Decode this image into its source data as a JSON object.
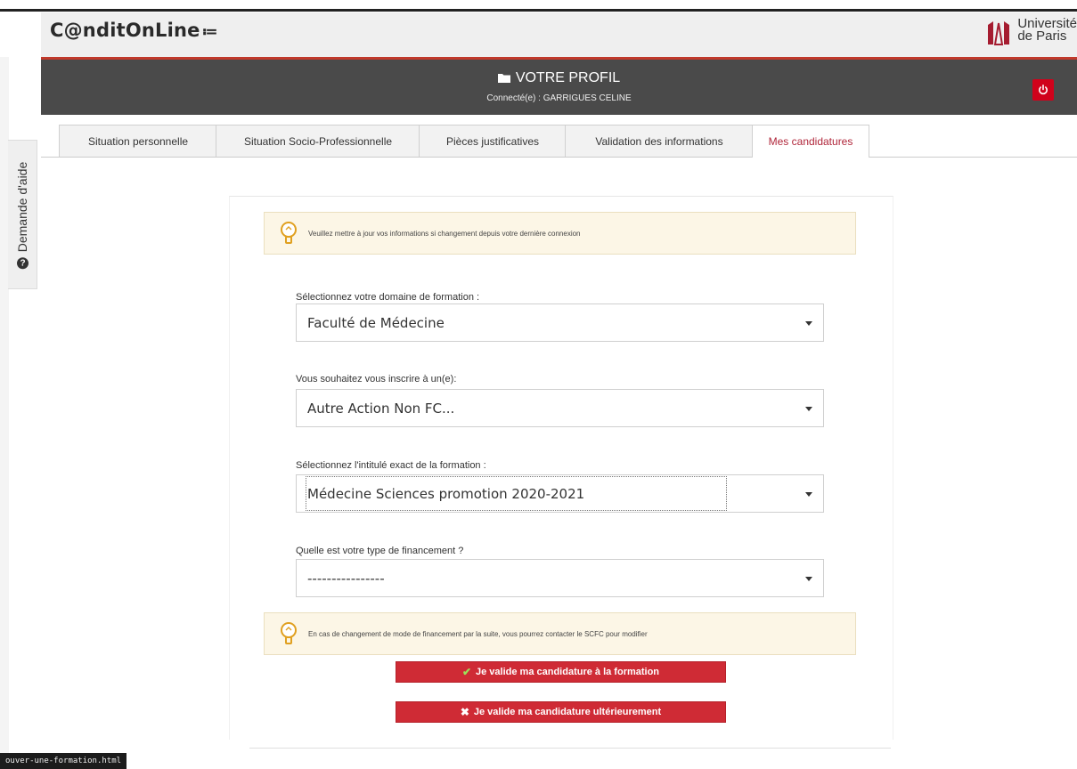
{
  "header": {
    "logo": "C@nditOnLine",
    "university_line1": "Université",
    "university_line2": "de Paris"
  },
  "banner": {
    "title": "VOTRE PROFIL",
    "connected": "Connecté(e) : GARRIGUES CELINE"
  },
  "tabs": [
    {
      "label": "Situation personnelle",
      "active": false
    },
    {
      "label": "Situation Socio-Professionnelle",
      "active": false
    },
    {
      "label": "Pièces justificatives",
      "active": false
    },
    {
      "label": "Validation des informations",
      "active": false
    },
    {
      "label": "Mes candidatures",
      "active": true
    }
  ],
  "help": {
    "label": "Demande d'aide"
  },
  "alerts": {
    "top": "Veuillez mettre à jour vos informations si changement depuis votre dernière connexion",
    "bottom": "En cas de changement de mode de financement par la suite, vous pourrez contacter le SCFC pour modifier"
  },
  "form": {
    "domain": {
      "label": "Sélectionnez votre domaine de formation :",
      "value": "Faculté de Médecine"
    },
    "inscription": {
      "label": "Vous souhaitez vous inscrire à un(e):",
      "value": "Autre Action Non FC..."
    },
    "formation": {
      "label": "Sélectionnez l'intitulé exact de la formation :",
      "value": "Médecine Sciences promotion 2020-2021"
    },
    "financement": {
      "label": "Quelle est votre type de financement ?",
      "value": "----------------"
    }
  },
  "buttons": {
    "validate_now": "Je valide ma candidature à la formation",
    "validate_later": "Je valide ma candidature ultérieurement"
  },
  "status_bar": {
    "url": "ouver-une-formation.html"
  },
  "colors": {
    "accent_red": "#cf2b35",
    "banner_dark": "#4a4a4a",
    "active_tab_text": "#b0263a",
    "alert_bg": "#fcf6e6"
  }
}
